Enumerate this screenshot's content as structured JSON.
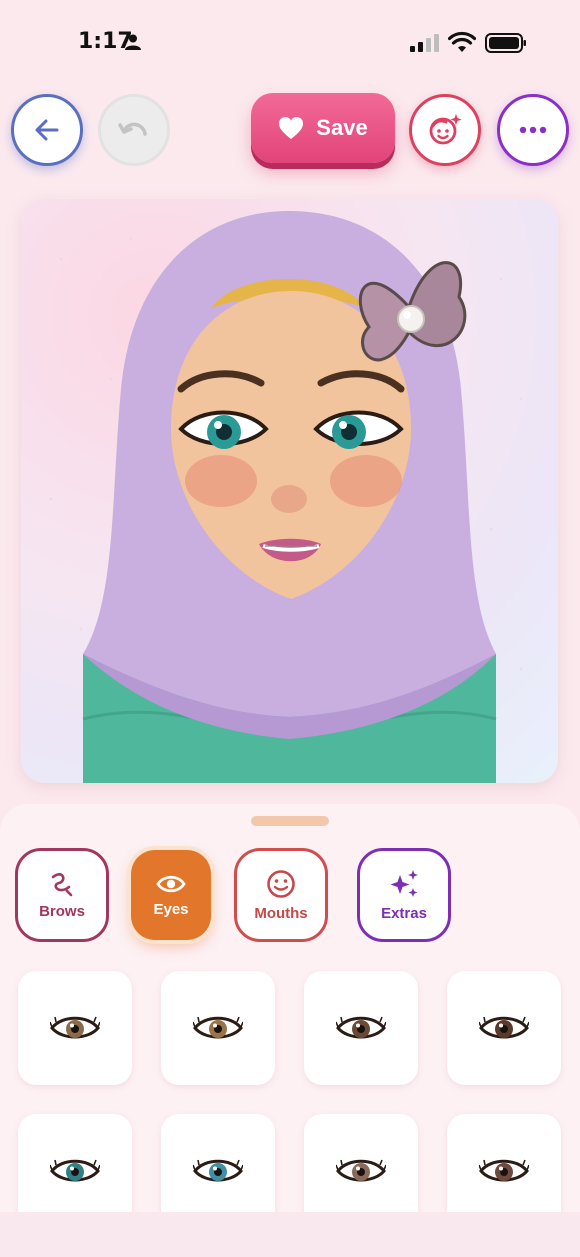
{
  "status_bar": {
    "time": "1:17"
  },
  "toolbar": {
    "save_label": "Save"
  },
  "tabs": [
    {
      "key": "brows",
      "label": "Brows"
    },
    {
      "key": "eyes",
      "label": "Eyes"
    },
    {
      "key": "mouths",
      "label": "Mouths"
    },
    {
      "key": "extras",
      "label": "Extras"
    }
  ],
  "selected_tab": "Eyes",
  "eye_options": [
    {
      "iris": "#8a6a4a"
    },
    {
      "iris": "#9a7446"
    },
    {
      "iris": "#6b4a35"
    },
    {
      "iris": "#5a3a28"
    },
    {
      "iris": "#2f7f86"
    },
    {
      "iris": "#3f8fa6"
    },
    {
      "iris": "#8b6a5a"
    },
    {
      "iris": "#6e4a3c"
    }
  ],
  "colors": {
    "accent_pink": "#e24479",
    "accent_orange": "#e2772c",
    "back_blue": "#5a6fc2",
    "purple": "#8a2fc9",
    "hijab": "#c9aee0",
    "shirt": "#4fb89c",
    "skin": "#f2c49d"
  }
}
